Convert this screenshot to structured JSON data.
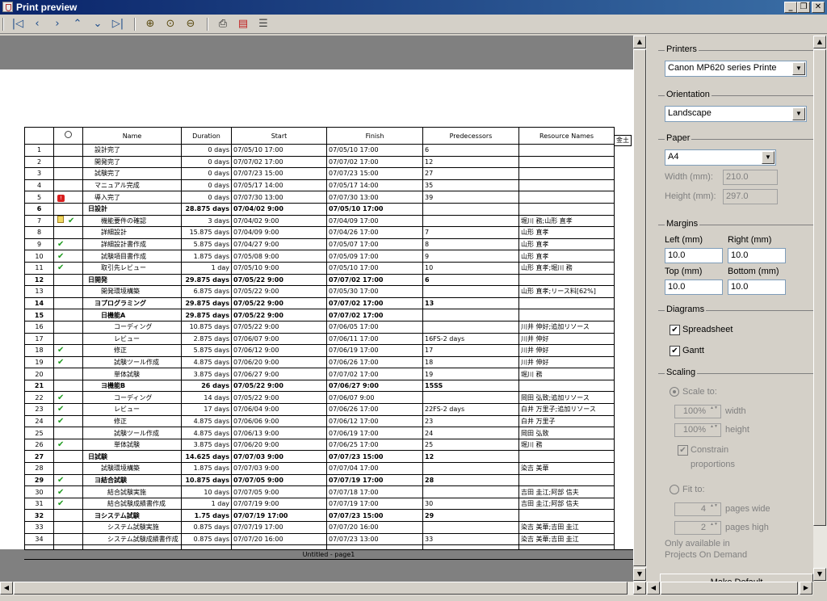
{
  "window": {
    "title": "Print preview",
    "controls": {
      "minimize": "_",
      "maximize": "❐",
      "close": "✕"
    }
  },
  "toolbar": {
    "buttons": [
      {
        "name": "first-page",
        "glyph": "|◁"
      },
      {
        "name": "previous",
        "glyph": "‹"
      },
      {
        "name": "next",
        "glyph": "›"
      },
      {
        "name": "page-up",
        "glyph": "⌃"
      },
      {
        "name": "page-down",
        "glyph": "⌄"
      },
      {
        "name": "last-page",
        "glyph": "▷|"
      },
      {
        "name": "zoom-in",
        "glyph": "⊕"
      },
      {
        "name": "zoom-reset",
        "glyph": "⊙"
      },
      {
        "name": "zoom-out",
        "glyph": "⊖"
      },
      {
        "name": "print",
        "glyph": "⎙"
      },
      {
        "name": "pdf",
        "glyph": "▤"
      },
      {
        "name": "settings",
        "glyph": "☰"
      }
    ]
  },
  "table": {
    "headers": [
      "",
      "",
      "Name",
      "Duration",
      "Start",
      "Finish",
      "Predecessors",
      "Resource Names"
    ],
    "extra_header": "金土",
    "rows": [
      {
        "id": "1",
        "icon": "",
        "name": "設計完了",
        "indent": 3,
        "duration": "0 days",
        "start": "07/05/10 17:00",
        "finish": "07/05/10 17:00",
        "pred": "6",
        "res": "",
        "bold": false
      },
      {
        "id": "2",
        "icon": "",
        "name": "開発完了",
        "indent": 3,
        "duration": "0 days",
        "start": "07/07/02 17:00",
        "finish": "07/07/02 17:00",
        "pred": "12",
        "res": "",
        "bold": false
      },
      {
        "id": "3",
        "icon": "",
        "name": "試験完了",
        "indent": 3,
        "duration": "0 days",
        "start": "07/07/23 15:00",
        "finish": "07/07/23 15:00",
        "pred": "27",
        "res": "",
        "bold": false
      },
      {
        "id": "4",
        "icon": "",
        "name": "マニュアル完成",
        "indent": 3,
        "duration": "0 days",
        "start": "07/05/17 14:00",
        "finish": "07/05/17 14:00",
        "pred": "35",
        "res": "",
        "bold": false
      },
      {
        "id": "5",
        "icon": "alert",
        "name": "導入完了",
        "indent": 3,
        "duration": "0 days",
        "start": "07/07/30 13:00",
        "finish": "07/07/30 13:00",
        "pred": "39",
        "res": "",
        "bold": false
      },
      {
        "id": "6",
        "icon": "",
        "name": "日設計",
        "indent": 1,
        "duration": "28.875 days",
        "start": "07/04/02 9:00",
        "finish": "07/05/10 17:00",
        "pred": "",
        "res": "",
        "bold": true
      },
      {
        "id": "7",
        "icon": "note-check",
        "name": "機能要件の確認",
        "indent": 5,
        "duration": "3 days",
        "start": "07/04/02 9:00",
        "finish": "07/04/09 17:00",
        "pred": "",
        "res": "堀川 務;山形 直孝",
        "bold": false
      },
      {
        "id": "8",
        "icon": "",
        "name": "詳細設計",
        "indent": 5,
        "duration": "15.875 days",
        "start": "07/04/09 9:00",
        "finish": "07/04/26 17:00",
        "pred": "7",
        "res": "山形 直孝",
        "bold": false
      },
      {
        "id": "9",
        "icon": "check",
        "name": "詳細設計書作成",
        "indent": 5,
        "duration": "5.875 days",
        "start": "07/04/27 9:00",
        "finish": "07/05/07 17:00",
        "pred": "8",
        "res": "山形 直孝",
        "bold": false
      },
      {
        "id": "10",
        "icon": "check",
        "name": "試験項目書作成",
        "indent": 5,
        "duration": "1.875 days",
        "start": "07/05/08 9:00",
        "finish": "07/05/09 17:00",
        "pred": "9",
        "res": "山形 直孝",
        "bold": false
      },
      {
        "id": "11",
        "icon": "check",
        "name": "取引先レビュー",
        "indent": 5,
        "duration": "1 day",
        "start": "07/05/10 9:00",
        "finish": "07/05/10 17:00",
        "pred": "10",
        "res": "山形 直孝;堀川 務",
        "bold": false
      },
      {
        "id": "12",
        "icon": "",
        "name": "日開発",
        "indent": 1,
        "duration": "29.875 days",
        "start": "07/05/22 9:00",
        "finish": "07/07/02 17:00",
        "pred": "6",
        "res": "",
        "bold": true
      },
      {
        "id": "13",
        "icon": "",
        "name": "開発環境構築",
        "indent": 5,
        "duration": "6.875 days",
        "start": "07/05/22 9:00",
        "finish": "07/05/30 17:00",
        "pred": "",
        "res": "山形 直孝;リース料[62%]",
        "bold": false
      },
      {
        "id": "14",
        "icon": "",
        "name": "ヨプログラミング",
        "indent": 3,
        "duration": "29.875 days",
        "start": "07/05/22 9:00",
        "finish": "07/07/02 17:00",
        "pred": "13",
        "res": "",
        "bold": true
      },
      {
        "id": "15",
        "icon": "",
        "name": "日機能A",
        "indent": 5,
        "duration": "29.875 days",
        "start": "07/05/22 9:00",
        "finish": "07/07/02 17:00",
        "pred": "",
        "res": "",
        "bold": true
      },
      {
        "id": "16",
        "icon": "",
        "name": "コーディング",
        "indent": 9,
        "duration": "10.875 days",
        "start": "07/05/22 9:00",
        "finish": "07/06/05 17:00",
        "pred": "",
        "res": "川井 伸好;追加リソース",
        "bold": false
      },
      {
        "id": "17",
        "icon": "",
        "name": "レビュー",
        "indent": 9,
        "duration": "2.875 days",
        "start": "07/06/07 9:00",
        "finish": "07/06/11 17:00",
        "pred": "16FS-2 days",
        "res": "川井 伸好",
        "bold": false
      },
      {
        "id": "18",
        "icon": "check",
        "name": "修正",
        "indent": 9,
        "duration": "5.875 days",
        "start": "07/06/12 9:00",
        "finish": "07/06/19 17:00",
        "pred": "17",
        "res": "川井 伸好",
        "bold": false
      },
      {
        "id": "19",
        "icon": "check",
        "name": "試験ツール作成",
        "indent": 9,
        "duration": "4.875 days",
        "start": "07/06/20 9:00",
        "finish": "07/06/26 17:00",
        "pred": "18",
        "res": "川井 伸好",
        "bold": false
      },
      {
        "id": "20",
        "icon": "",
        "name": "単体試験",
        "indent": 9,
        "duration": "3.875 days",
        "start": "07/06/27 9:00",
        "finish": "07/07/02 17:00",
        "pred": "19",
        "res": "堀川 務",
        "bold": false
      },
      {
        "id": "21",
        "icon": "",
        "name": "ヨ機能B",
        "indent": 5,
        "duration": "26 days",
        "start": "07/05/22 9:00",
        "finish": "07/06/27 9:00",
        "pred": "15SS",
        "res": "",
        "bold": true
      },
      {
        "id": "22",
        "icon": "check",
        "name": "コーディング",
        "indent": 9,
        "duration": "14 days",
        "start": "07/05/22 9:00",
        "finish": "07/06/07 9:00",
        "pred": "",
        "res": "岡田 弘致;追加リソース",
        "bold": false
      },
      {
        "id": "23",
        "icon": "check",
        "name": "レビュー",
        "indent": 9,
        "duration": "17 days",
        "start": "07/06/04 9:00",
        "finish": "07/06/26 17:00",
        "pred": "22FS-2 days",
        "res": "白井 万里子;追加リソース",
        "bold": false
      },
      {
        "id": "24",
        "icon": "check",
        "name": "修正",
        "indent": 9,
        "duration": "4.875 days",
        "start": "07/06/06 9:00",
        "finish": "07/06/12 17:00",
        "pred": "23",
        "res": "白井 万里子",
        "bold": false
      },
      {
        "id": "25",
        "icon": "",
        "name": "試験ツール作成",
        "indent": 9,
        "duration": "4.875 days",
        "start": "07/06/13 9:00",
        "finish": "07/06/19 17:00",
        "pred": "24",
        "res": "岡田 弘致",
        "bold": false
      },
      {
        "id": "26",
        "icon": "check",
        "name": "単体試験",
        "indent": 9,
        "duration": "3.875 days",
        "start": "07/06/20 9:00",
        "finish": "07/06/25 17:00",
        "pred": "25",
        "res": "堀川 務",
        "bold": false
      },
      {
        "id": "27",
        "icon": "",
        "name": "日試験",
        "indent": 1,
        "duration": "14.625 days",
        "start": "07/07/03 9:00",
        "finish": "07/07/23 15:00",
        "pred": "12",
        "res": "",
        "bold": true
      },
      {
        "id": "28",
        "icon": "",
        "name": "試験環境構築",
        "indent": 5,
        "duration": "1.875 days",
        "start": "07/07/03 9:00",
        "finish": "07/07/04 17:00",
        "pred": "",
        "res": "染吉 美華",
        "bold": false
      },
      {
        "id": "29",
        "icon": "check",
        "name": "ヨ結合試験",
        "indent": 3,
        "duration": "10.875 days",
        "start": "07/07/05 9:00",
        "finish": "07/07/19 17:00",
        "pred": "28",
        "res": "",
        "bold": true
      },
      {
        "id": "30",
        "icon": "check",
        "name": "結合試験実施",
        "indent": 7,
        "duration": "10 days",
        "start": "07/07/05 9:00",
        "finish": "07/07/18 17:00",
        "pred": "",
        "res": "吉田 圭江;阿部 信夫",
        "bold": false
      },
      {
        "id": "31",
        "icon": "check",
        "name": "結合試験成績書作成",
        "indent": 7,
        "duration": "1 day",
        "start": "07/07/19 9:00",
        "finish": "07/07/19 17:00",
        "pred": "30",
        "res": "吉田 圭江;阿部 信夫",
        "bold": false
      },
      {
        "id": "32",
        "icon": "",
        "name": "ヨシステム試験",
        "indent": 3,
        "duration": "1.75 days",
        "start": "07/07/19 17:00",
        "finish": "07/07/23 15:00",
        "pred": "29",
        "res": "",
        "bold": true
      },
      {
        "id": "33",
        "icon": "",
        "name": "システム試験実施",
        "indent": 7,
        "duration": "0.875 days",
        "start": "07/07/19 17:00",
        "finish": "07/07/20 16:00",
        "pred": "",
        "res": "染吉 美華;吉田 圭江",
        "bold": false
      },
      {
        "id": "34",
        "icon": "",
        "name": "システム試験成績書作成",
        "indent": 7,
        "duration": "0.875 days",
        "start": "07/07/20 16:00",
        "finish": "07/07/23 13:00",
        "pred": "33",
        "res": "染吉 美華;吉田 圭江",
        "bold": false
      }
    ],
    "footer": "Untitled  -  page1"
  },
  "panel": {
    "printers": {
      "title": "Printers",
      "value": "Canon MP620 series Printe"
    },
    "orientation": {
      "title": "Orientation",
      "value": "Landscape"
    },
    "paper": {
      "title": "Paper",
      "value": "A4",
      "width_label": "Width (mm):",
      "width_value": "210.0",
      "height_label": "Height (mm):",
      "height_value": "297.0"
    },
    "margins": {
      "title": "Margins",
      "left_label": "Left (mm)",
      "left_value": "10.0",
      "right_label": "Right (mm)",
      "right_value": "10.0",
      "top_label": "Top (mm)",
      "top_value": "10.0",
      "bottom_label": "Bottom (mm)",
      "bottom_value": "10.0"
    },
    "diagrams": {
      "title": "Diagrams",
      "spreadsheet_label": "Spreadsheet",
      "spreadsheet_checked": true,
      "gantt_label": "Gantt",
      "gantt_checked": true
    },
    "scaling": {
      "title": "Scaling",
      "scale_to_label": "Scale to:",
      "width_value": "100%",
      "width_label": "width",
      "height_value": "100%",
      "height_label": "height",
      "constrain_label": "Constrain",
      "proportions_label": "proportions",
      "fit_to_label": "Fit to:",
      "pages_wide_value": "4",
      "pages_wide_label": "pages wide",
      "pages_high_value": "2",
      "pages_high_label": "pages high",
      "note_line1": "Only available in",
      "note_line2": "Projects On Demand"
    },
    "make_default_label": "Make Default"
  }
}
